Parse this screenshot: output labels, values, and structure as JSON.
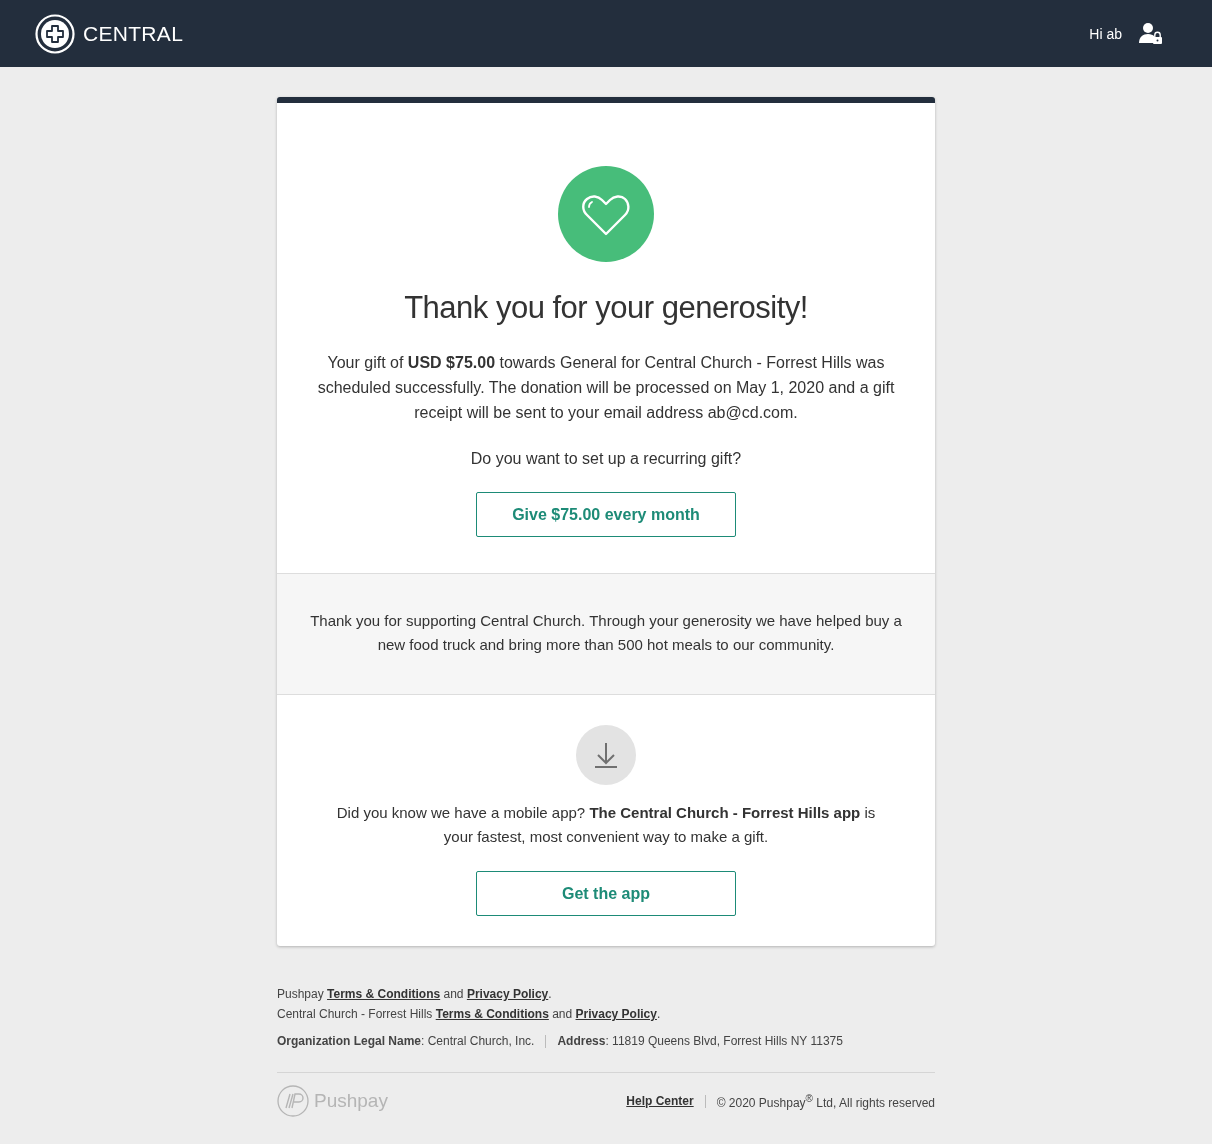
{
  "header": {
    "brand": "CENTRAL",
    "greeting": "Hi ab"
  },
  "confirmation": {
    "title": "Thank you for your generosity!",
    "message": "Your gift of **USD $75.00** towards General for Central Church - Forrest Hills was scheduled successfully. The donation will be processed on May 1, 2020 and a gift receipt will be sent to your email address ab@cd.com.",
    "question": "Do you want to set up a recurring gift?",
    "button": "Give $75.00 every month"
  },
  "impact": {
    "message": "Thank you for supporting Central Church. Through your generosity we have helped buy a new food truck and bring more than 500 hot meals to our community."
  },
  "app": {
    "message": "Did you know we have a mobile app? **The Central Church - Forrest Hills app** is your fastest, most convenient way to make a gift.",
    "button": "Get the app"
  },
  "footer": {
    "policy_lines": [
      {
        "prefix": "Pushpay",
        "terms": "Terms & Conditions",
        "joiner": "and",
        "privacy": "Privacy Policy",
        "suffix": "."
      },
      {
        "prefix": "Central Church - Forrest Hills",
        "terms": "Terms & Conditions",
        "joiner": "and",
        "privacy": "Privacy Policy",
        "suffix": "."
      }
    ],
    "legal": [
      "**Organization Legal Name**: Central Church, Inc.",
      "**Address**: 11819 Queens Blvd, Forrest Hills NY 11375"
    ],
    "logo": "Pushpay",
    "help": "Help Center",
    "copyright": "© 2020 Pushpay$^{®}$ Ltd, All rights reserved"
  }
}
